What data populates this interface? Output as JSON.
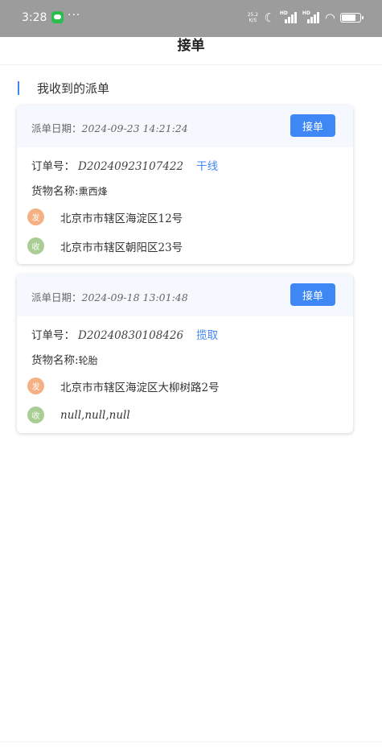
{
  "status_bar": {
    "time": "3:28",
    "dots": "···",
    "speed": "25.2 K/S",
    "icons": [
      "wechat-icon",
      "moon-icon",
      "signal-hd-icon",
      "signal-hd-icon",
      "wifi-icon",
      "battery-icon"
    ],
    "battery_percent": 85
  },
  "header": {
    "title": "接单"
  },
  "section": {
    "title": "我收到的派单"
  },
  "orders": [
    {
      "date_label": "派单日期：",
      "date": "2024-09-23 14:21:24",
      "accept_label": "接单",
      "order_label": "订单号：",
      "order_no": "D20240923107422",
      "tag": "干线",
      "goods_label": "货物名称:",
      "goods": "熏西烽",
      "send_icon": "发",
      "send_address": "北京市市辖区海淀区12号",
      "recv_icon": "收",
      "recv_address": "北京市市辖区朝阳区23号"
    },
    {
      "date_label": "派单日期：",
      "date": "2024-09-18 13:01:48",
      "accept_label": "接单",
      "order_label": "订单号：",
      "order_no": "D20240830108426",
      "tag": "揽取",
      "goods_label": "货物名称:",
      "goods": "轮胎",
      "send_icon": "发",
      "send_address": "北京市市辖区海淀区大柳树路2号",
      "recv_icon": "收",
      "recv_address": "null,null,null"
    }
  ],
  "colors": {
    "accent": "#3f87f5",
    "send_icon": "#f5b083",
    "recv_icon": "#a9cd94",
    "status_bar": "#9c9c9c",
    "card_header": "#f5f8fe"
  }
}
